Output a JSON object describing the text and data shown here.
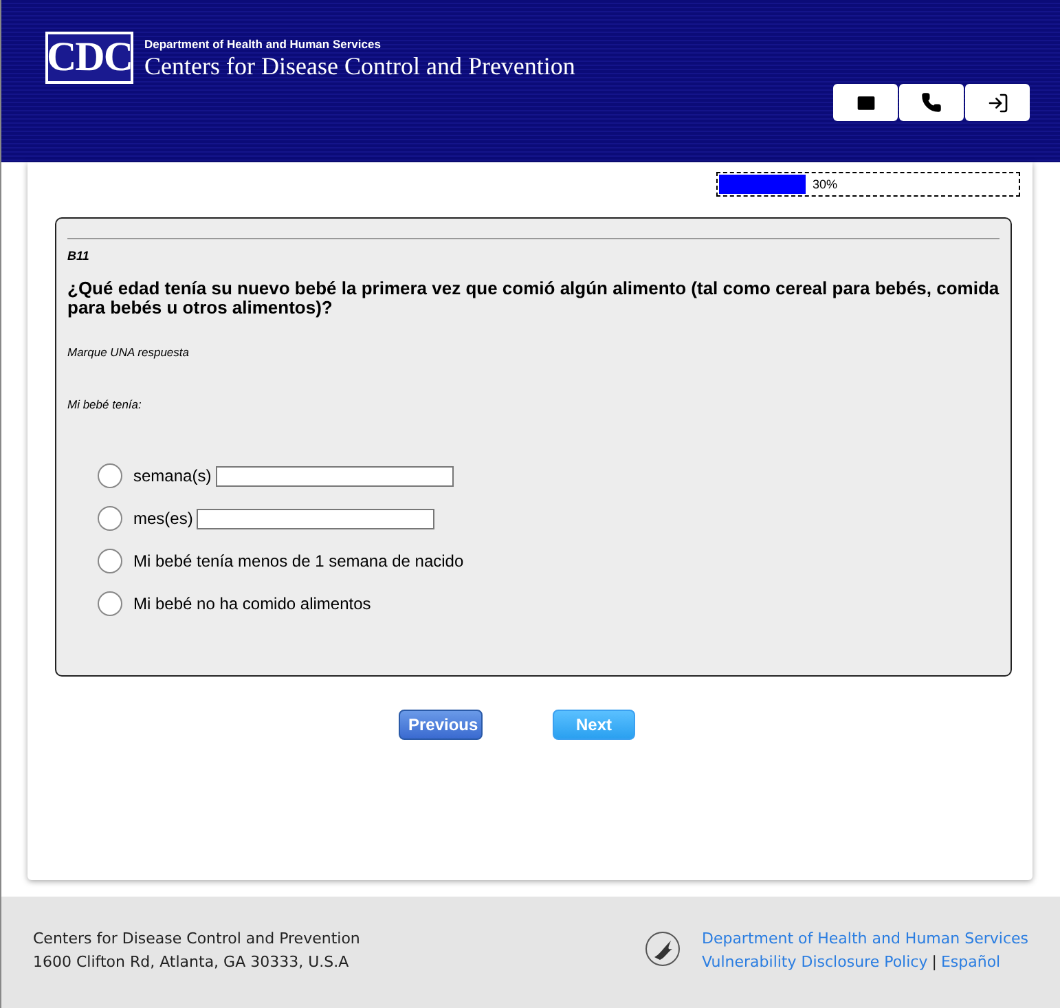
{
  "header": {
    "logo": "CDC",
    "department": "Department of Health and Human Services",
    "agency": "Centers for Disease Control and Prevention"
  },
  "progress": {
    "level": 0.3,
    "reading": "30%"
  },
  "question": {
    "code": "B11",
    "text": "¿Qué edad tenía su nuevo bebé la primera vez que comió algún alimento (tal como cereal para bebés, comida para bebés u otros alimentos)?",
    "instruction": "Marque UNA respuesta",
    "lead": "Mi bebé tenía:",
    "options": [
      {
        "label": "semana(s)",
        "kind": "input",
        "selected": false
      },
      {
        "label": "mes(es)",
        "kind": "input",
        "selected": false
      },
      {
        "label": "Mi bebé tenía menos de 1 semana de nacido",
        "kind": "plain",
        "selected": false
      },
      {
        "label": "Mi bebé no ha comido alimentos",
        "kind": "plain",
        "selected": false
      }
    ]
  },
  "buttons": [
    "Previous",
    "Next"
  ],
  "footer": {
    "lines": [
      "Centers for Disease Control and Prevention",
      "1600 Clifton Rd, Atlanta, GA 30333, U.S.A"
    ],
    "links": [
      "Department of Health and Human Services",
      "Vulnerability Disclosure Policy",
      "Español"
    ],
    "separator": "|"
  }
}
